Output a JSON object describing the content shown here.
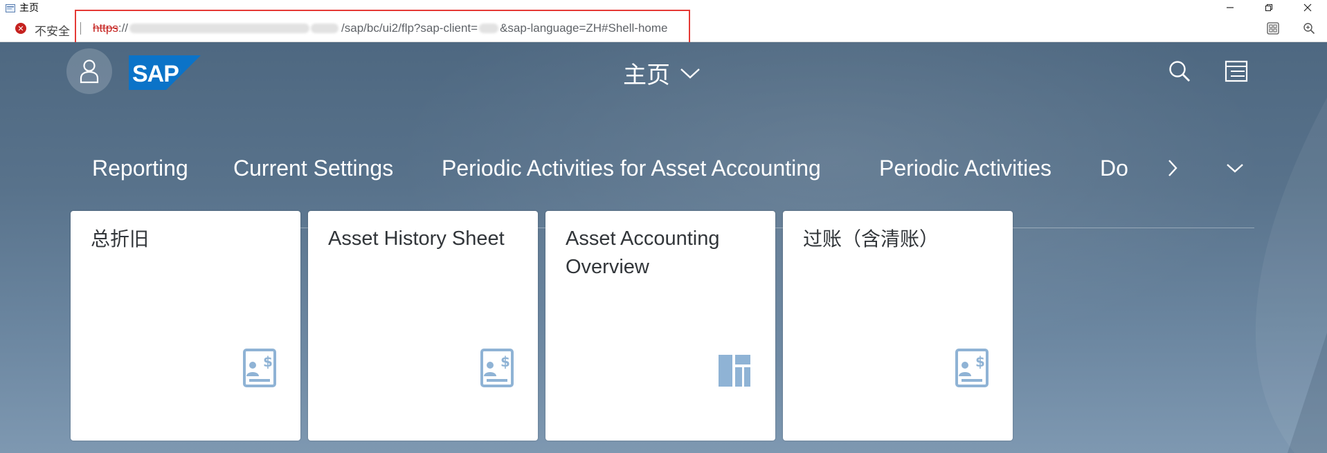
{
  "window": {
    "title": "主页",
    "controls": [
      "minimize-icon",
      "restore-icon",
      "close-icon"
    ]
  },
  "addressbar": {
    "security_label": "不安全",
    "url_scheme": "https",
    "url_sep": "://",
    "url_path": "/sap/bc/ui2/flp?sap-client=",
    "url_query_rest": "&sap-language=ZH#Shell-home",
    "tools": [
      "app-grid-icon",
      "zoom-icon"
    ],
    "highlight_color": "#e53935"
  },
  "shell": {
    "title": "主页",
    "logo_text": "SAP",
    "logo_color": "#0b73c8",
    "background_color": "#56708a",
    "header_icons": [
      "avatar-icon",
      "search-icon",
      "notifications-icon"
    ]
  },
  "tabs": {
    "items": [
      {
        "label": "Reporting",
        "active": true
      },
      {
        "label": "Current Settings",
        "active": false
      },
      {
        "label": "Periodic Activities for Asset Accounting",
        "active": false
      },
      {
        "label": "Periodic Activities",
        "active": false
      },
      {
        "label": "Do",
        "active": false
      }
    ],
    "overflow_icons": [
      "chevron-right-icon",
      "chevron-down-icon"
    ]
  },
  "tiles": [
    {
      "title": "总折旧",
      "icon": "report-icon"
    },
    {
      "title": "Asset History Sheet",
      "icon": "report-icon"
    },
    {
      "title": "Asset Accounting Overview",
      "icon": "overview-icon"
    },
    {
      "title": "过账（含清账）",
      "icon": "report-icon"
    }
  ],
  "tile_icon_color": "#8fb3d5"
}
